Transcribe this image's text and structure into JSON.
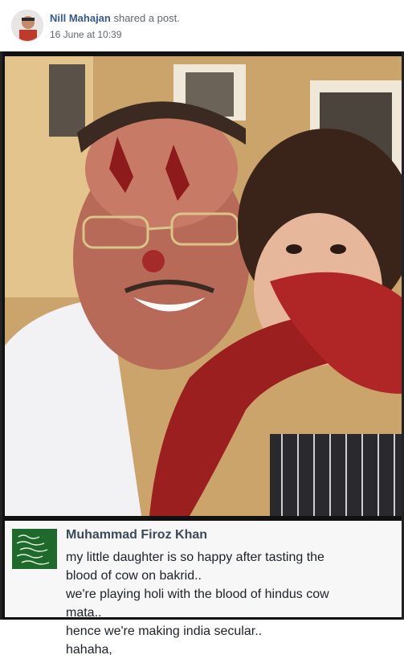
{
  "post": {
    "author": "Nill Mahajan",
    "action": " shared a post.",
    "timestamp": "16 June at 10:39"
  },
  "shared": {
    "author": "Muhammad Firoz Khan",
    "lines": [
      "my little daughter is so happy after tasting the",
      "blood of cow on bakrid..",
      "we're playing holi with the blood of hindus cow",
      "mata..",
      "hence we're making india secular..",
      "hahaha,"
    ]
  },
  "colors": {
    "link": "#365899",
    "meta": "#616770",
    "caption_bg": "#f7f7f7"
  }
}
